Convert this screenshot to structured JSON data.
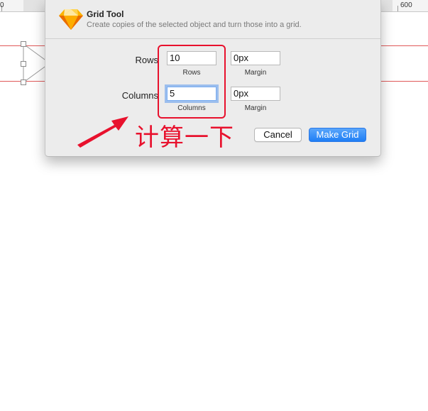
{
  "ruler": {
    "label_left": "0",
    "label_right": "600"
  },
  "dialog": {
    "title": "Grid Tool",
    "subtitle": "Create copies of the selected object and turn those into a grid.",
    "rows": {
      "label": "Rows",
      "value": "10",
      "sub_label": "Rows",
      "margin_value": "0px",
      "margin_label": "Margin"
    },
    "columns": {
      "label": "Columns",
      "value": "5",
      "sub_label": "Columns",
      "margin_value": "0px",
      "margin_label": "Margin"
    },
    "cancel_label": "Cancel",
    "confirm_label": "Make Grid"
  },
  "annotation": {
    "text": "计算一下",
    "color": "#e8112d"
  },
  "colors": {
    "accent": "#1f7ef5",
    "guide": "#e05a5a",
    "focus_ring": "#5b99ee"
  },
  "icons": {
    "app": "sketch-diamond-icon",
    "arrow": "annotation-arrow-icon"
  }
}
